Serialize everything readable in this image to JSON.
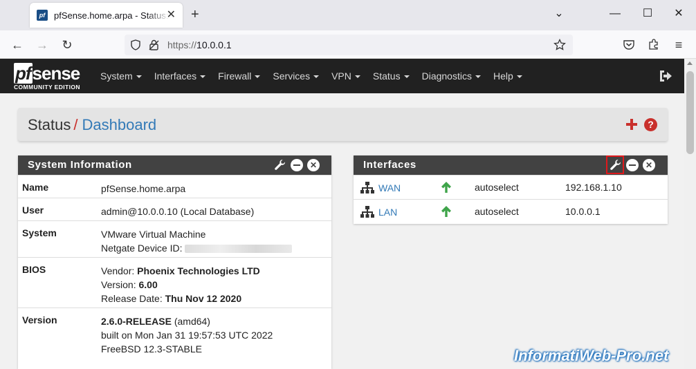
{
  "browser": {
    "tab_title": "pfSense.home.arpa - Status: Dashboard",
    "favicon_text": "pf",
    "url_protocol": "https://",
    "url_host": "10.0.0.1",
    "icons": [
      "close-icon",
      "new-tab-icon",
      "back-icon",
      "forward-icon",
      "reload-icon",
      "shield-icon",
      "lock-icon",
      "bookmark-star-icon",
      "pocket-icon",
      "extensions-icon",
      "menu-icon"
    ]
  },
  "pfsense": {
    "logo_pf": "pf",
    "logo_sense": "sense",
    "logo_edition": "COMMUNITY EDITION",
    "menu": [
      "System",
      "Interfaces",
      "Firewall",
      "Services",
      "VPN",
      "Status",
      "Diagnostics",
      "Help"
    ]
  },
  "breadcrumb": {
    "section": "Status",
    "separator": "/",
    "page": "Dashboard",
    "add_icon": "plus-icon",
    "help_label": "?"
  },
  "system_info": {
    "title": "System Information",
    "rows": [
      {
        "label": "Name",
        "lines": [
          "pfSense.home.arpa"
        ]
      },
      {
        "label": "User",
        "lines": [
          "admin@10.0.0.10 (Local Database)"
        ]
      },
      {
        "label": "System",
        "line1": "VMware Virtual Machine",
        "line2_prefix": "Netgate Device ID: "
      },
      {
        "label": "BIOS",
        "vendor_prefix": "Vendor: ",
        "vendor": "Phoenix Technologies LTD",
        "version_prefix": "Version: ",
        "version": "6.00",
        "date_prefix": "Release Date: ",
        "date": "Thu Nov 12 2020"
      },
      {
        "label": "Version",
        "release": "2.6.0-RELEASE",
        "arch": " (amd64)",
        "built": "built on Mon Jan 31 19:57:53 UTC 2022",
        "freebsd": "FreeBSD 12.3-STABLE"
      }
    ]
  },
  "interfaces": {
    "title": "Interfaces",
    "rows": [
      {
        "name": "WAN",
        "status": "up",
        "media": "autoselect",
        "ip": "192.168.1.10"
      },
      {
        "name": "LAN",
        "status": "up",
        "media": "autoselect",
        "ip": "10.0.0.1"
      }
    ]
  },
  "colors": {
    "header_bg": "#212121",
    "widget_head": "#424242",
    "link": "#337ab7",
    "accent_red": "#c9302c",
    "status_up": "#3fa44a"
  },
  "watermark": "InformatiWeb-Pro.net"
}
